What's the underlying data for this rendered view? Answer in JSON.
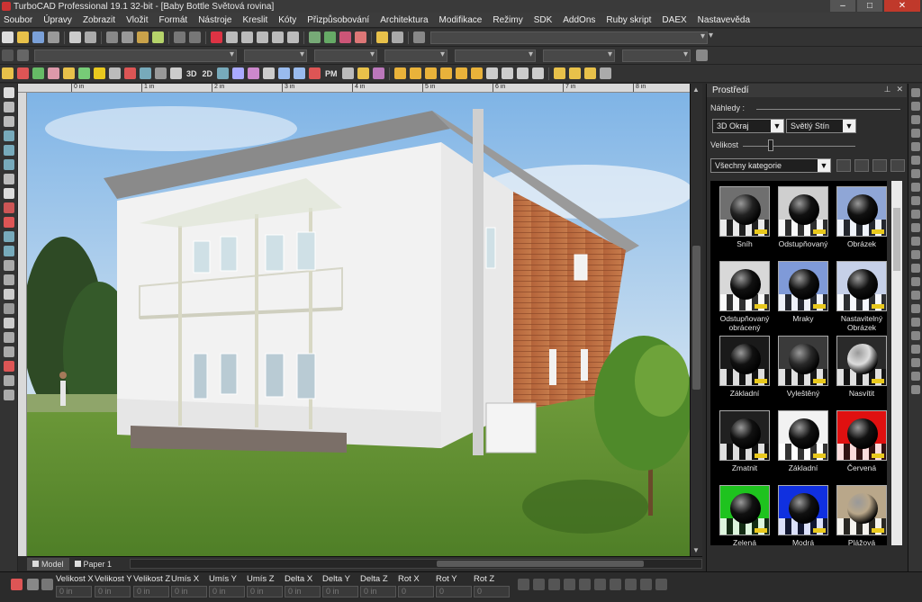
{
  "window": {
    "title": "TurboCAD Professional 19.1 32-bit - [Baby Bottle Světová rovina]",
    "minimize": "–",
    "maximize": "□",
    "close": "✕"
  },
  "menu": {
    "items": [
      "Soubor",
      "Úpravy",
      "Zobrazit",
      "Vložit",
      "Formát",
      "Nástroje",
      "Kreslit",
      "Kóty",
      "Přizpůsobování",
      "Architektura",
      "Modifikace",
      "Režimy",
      "SDK",
      "AddOns",
      "Ruby skript",
      "DAEX",
      "Nastavevěda"
    ]
  },
  "toolbar3": {
    "label_3d": "3D",
    "label_2d": "2D",
    "label_pm": "PM"
  },
  "ruler": {
    "ticks": [
      "0 in",
      "1 in",
      "2 in",
      "3 in",
      "4 in",
      "5 in",
      "6 in",
      "7 in",
      "8 in"
    ]
  },
  "tabs": {
    "model": "Model",
    "paper": "Paper 1"
  },
  "panel": {
    "title": "Prostředí",
    "previews_label": "Náhledy :",
    "size_label": "Velikost",
    "render_mode": "3D Okraj",
    "shading": "Světlý Stín",
    "category": "Všechny kategorie",
    "materials": [
      {
        "label": "Sníh",
        "bg": "#6f6f6f",
        "ball": "#222"
      },
      {
        "label": "Odstupňovaný",
        "bg": "#cfcfcf",
        "ball": "#111"
      },
      {
        "label": "Obrázek",
        "bg": "#8fa6d6",
        "ball": "#111"
      },
      {
        "label": "Odstupňovaný obrácený",
        "bg": "#d8d8d8",
        "ball": "#111"
      },
      {
        "label": "Mraky",
        "bg": "#7f9ad8",
        "ball": "#111"
      },
      {
        "label": "Nastavitelný Obrázek",
        "bg": "#c6d0e8",
        "ball": "#111"
      },
      {
        "label": "Základní",
        "bg": "#1a1a1a",
        "ball": "#111"
      },
      {
        "label": "Vyleštěný",
        "bg": "#3a3a3a",
        "ball": "#2a2a2a"
      },
      {
        "label": "Nasvítit",
        "bg": "#2a2a2a",
        "ball": "#ddd"
      },
      {
        "label": "Zmatnit",
        "bg": "#202020",
        "ball": "#111"
      },
      {
        "label": "Základní",
        "bg": "#f2f2f2",
        "ball": "#111"
      },
      {
        "label": "Červená",
        "bg": "#e01010",
        "ball": "#111"
      },
      {
        "label": "Zelená",
        "bg": "#1ec31e",
        "ball": "#111"
      },
      {
        "label": "Modrá",
        "bg": "#1030e0",
        "ball": "#111"
      },
      {
        "label": "Plážová",
        "bg": "#b9a78a",
        "ball": "#b9a78a"
      }
    ]
  },
  "status": {
    "labels": [
      "Velikost X",
      "Velikost Y",
      "Velikost Z",
      "Umís X",
      "Umís Y",
      "Umís Z",
      "Delta X",
      "Delta Y",
      "Delta Z",
      "Rot X",
      "Rot Y",
      "Rot Z"
    ],
    "values": [
      "0 in",
      "0 in",
      "0 in",
      "0 in",
      "0 in",
      "0 in",
      "0 in",
      "0 in",
      "0 in",
      "0",
      "0",
      "0"
    ]
  }
}
